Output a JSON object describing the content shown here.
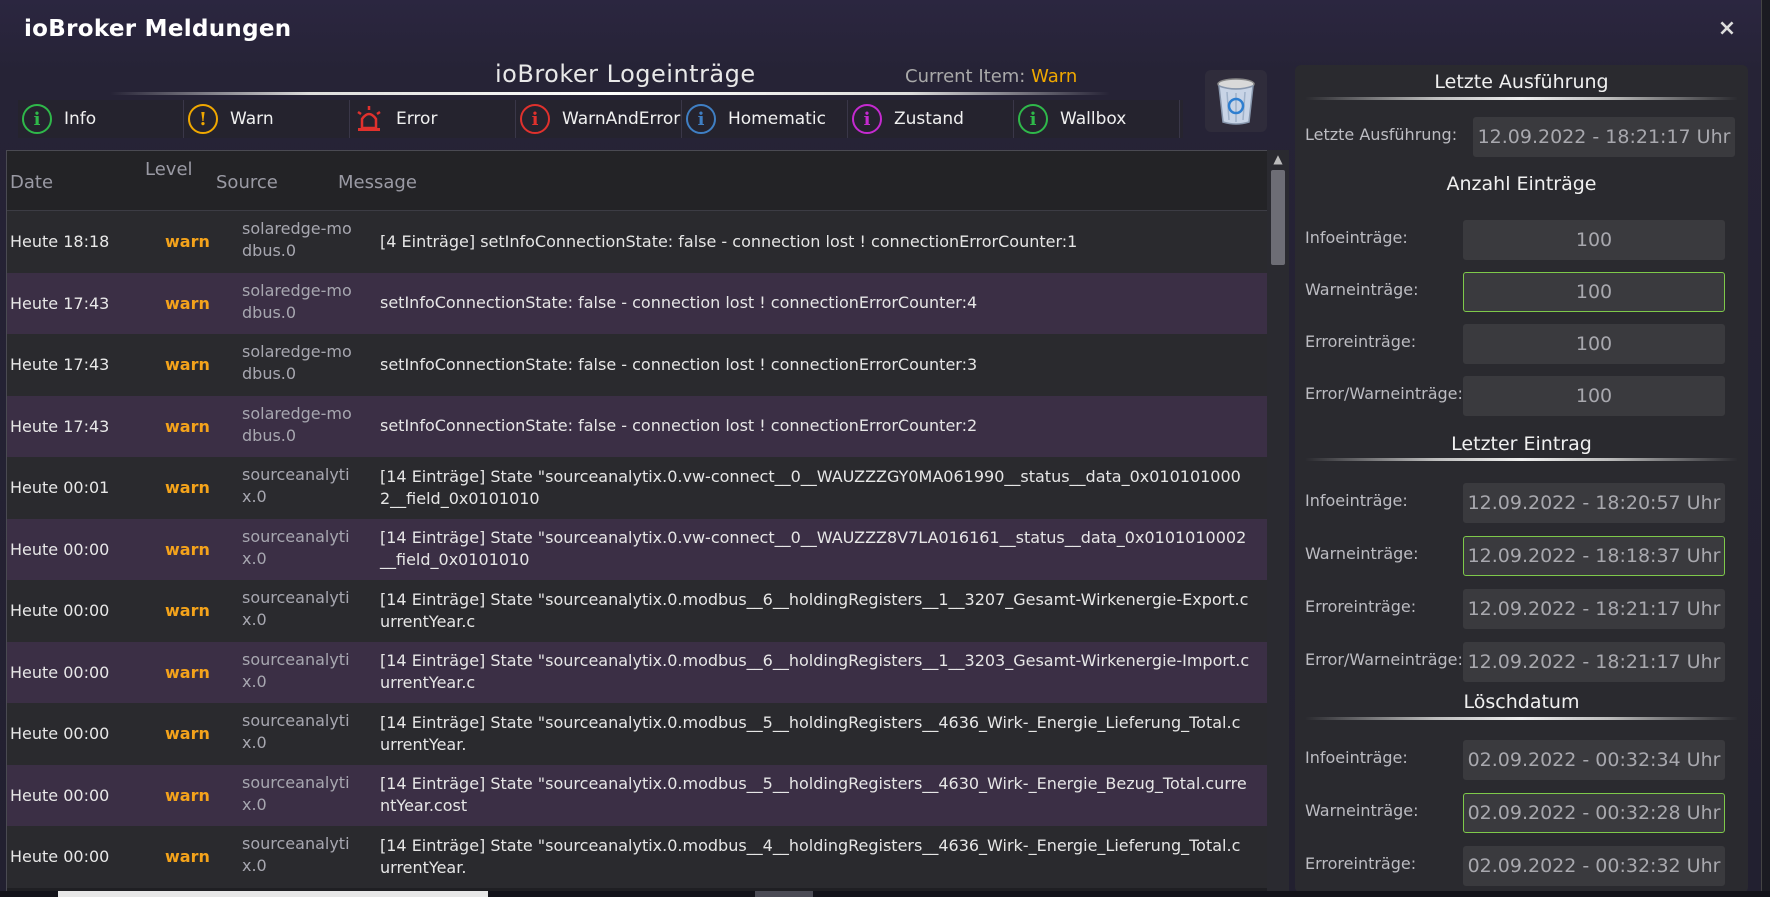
{
  "window": {
    "title": "ioBroker Meldungen",
    "close_icon": "×"
  },
  "log": {
    "title": "ioBroker Logeinträge",
    "current_item_label": "Current Item:",
    "current_item_value": "Warn"
  },
  "tabs": [
    {
      "label": "Info",
      "icon": "info-icon",
      "color": "#2fb84a",
      "glyph": "i"
    },
    {
      "label": "Warn",
      "icon": "warning-icon",
      "color": "#f0a800",
      "glyph": "!"
    },
    {
      "label": "Error",
      "icon": "siren-icon",
      "color": "#e0312d",
      "glyph": ""
    },
    {
      "label": "WarnAndError",
      "icon": "info-icon",
      "color": "#e0312d",
      "glyph": "i"
    },
    {
      "label": "Homematic",
      "icon": "info-icon",
      "color": "#3f7fc4",
      "glyph": "i"
    },
    {
      "label": "Zustand",
      "icon": "info-icon",
      "color": "#c52ad0",
      "glyph": "i"
    },
    {
      "label": "Wallbox",
      "icon": "info-icon",
      "color": "#2fb84a",
      "glyph": "i"
    }
  ],
  "table": {
    "headers": {
      "date": "Date",
      "level": "Level",
      "source": "Source",
      "message": "Message"
    },
    "rows": [
      {
        "date": "Heute 18:18",
        "level": "warn",
        "source": "solaredge-modbus.0",
        "message": "[4 Einträge] setInfoConnectionState: false - connection lost ! connectionErrorCounter:1"
      },
      {
        "date": "Heute 17:43",
        "level": "warn",
        "source": "solaredge-modbus.0",
        "message": "setInfoConnectionState: false - connection lost ! connectionErrorCounter:4"
      },
      {
        "date": "Heute 17:43",
        "level": "warn",
        "source": "solaredge-modbus.0",
        "message": "setInfoConnectionState: false - connection lost ! connectionErrorCounter:3"
      },
      {
        "date": "Heute 17:43",
        "level": "warn",
        "source": "solaredge-modbus.0",
        "message": "setInfoConnectionState: false - connection lost ! connectionErrorCounter:2"
      },
      {
        "date": "Heute 00:01",
        "level": "warn",
        "source": "sourceanalytix.0",
        "message": "[14 Einträge] State \"sourceanalytix.0.vw-connect__0__WAUZZZGY0MA061990__status__data_0x0101010002__field_0x0101010"
      },
      {
        "date": "Heute 00:00",
        "level": "warn",
        "source": "sourceanalytix.0",
        "message": "[14 Einträge] State \"sourceanalytix.0.vw-connect__0__WAUZZZ8V7LA016161__status__data_0x0101010002__field_0x0101010"
      },
      {
        "date": "Heute 00:00",
        "level": "warn",
        "source": "sourceanalytix.0",
        "message": "[14 Einträge] State \"sourceanalytix.0.modbus__6__holdingRegisters__1__3207_Gesamt-Wirkenergie-Export.currentYear.c"
      },
      {
        "date": "Heute 00:00",
        "level": "warn",
        "source": "sourceanalytix.0",
        "message": "[14 Einträge] State \"sourceanalytix.0.modbus__6__holdingRegisters__1__3203_Gesamt-Wirkenergie-Import.currentYear.c"
      },
      {
        "date": "Heute 00:00",
        "level": "warn",
        "source": "sourceanalytix.0",
        "message": "[14 Einträge] State \"sourceanalytix.0.modbus__5__holdingRegisters__4636_Wirk-_Energie_Lieferung_Total.currentYear."
      },
      {
        "date": "Heute 00:00",
        "level": "warn",
        "source": "sourceanalytix.0",
        "message": "[14 Einträge] State \"sourceanalytix.0.modbus__5__holdingRegisters__4630_Wirk-_Energie_Bezug_Total.currentYear.cost"
      },
      {
        "date": "Heute 00:00",
        "level": "warn",
        "source": "sourceanalytix.0",
        "message": "[14 Einträge] State \"sourceanalytix.0.modbus__4__holdingRegisters__4636_Wirk-_Energie_Lieferung_Total.currentYear."
      }
    ]
  },
  "right": {
    "last_run": {
      "title": "Letzte Ausführung",
      "label": "Letzte Ausführung:",
      "value": "12.09.2022 - 18:21:17 Uhr"
    },
    "counts": {
      "title": "Anzahl Einträge",
      "items": [
        {
          "label": "Infoeinträge:",
          "value": "100",
          "highlight": false
        },
        {
          "label": "Warneinträge:",
          "value": "100",
          "highlight": true
        },
        {
          "label": "Erroreinträge:",
          "value": "100",
          "highlight": false
        },
        {
          "label": "Error/Warneinträge:",
          "value": "100",
          "highlight": false
        }
      ]
    },
    "last_entry": {
      "title": "Letzter Eintrag",
      "items": [
        {
          "label": "Infoeinträge:",
          "value": "12.09.2022 - 18:20:57 Uhr",
          "highlight": false
        },
        {
          "label": "Warneinträge:",
          "value": "12.09.2022 - 18:18:37 Uhr",
          "highlight": true
        },
        {
          "label": "Erroreinträge:",
          "value": "12.09.2022 - 18:21:17 Uhr",
          "highlight": false
        },
        {
          "label": "Error/Warneinträge:",
          "value": "12.09.2022 - 18:21:17 Uhr",
          "highlight": false
        }
      ]
    },
    "delete_date": {
      "title": "Löschdatum",
      "items": [
        {
          "label": "Infoeinträge:",
          "value": "02.09.2022 - 00:32:34 Uhr",
          "highlight": false
        },
        {
          "label": "Warneinträge:",
          "value": "02.09.2022 - 00:32:28 Uhr",
          "highlight": true
        },
        {
          "label": "Erroreinträge:",
          "value": "02.09.2022 - 00:32:32 Uhr",
          "highlight": false
        }
      ]
    }
  },
  "colors": {
    "warn": "#f4a31b",
    "accent_green": "#7ec94a"
  }
}
